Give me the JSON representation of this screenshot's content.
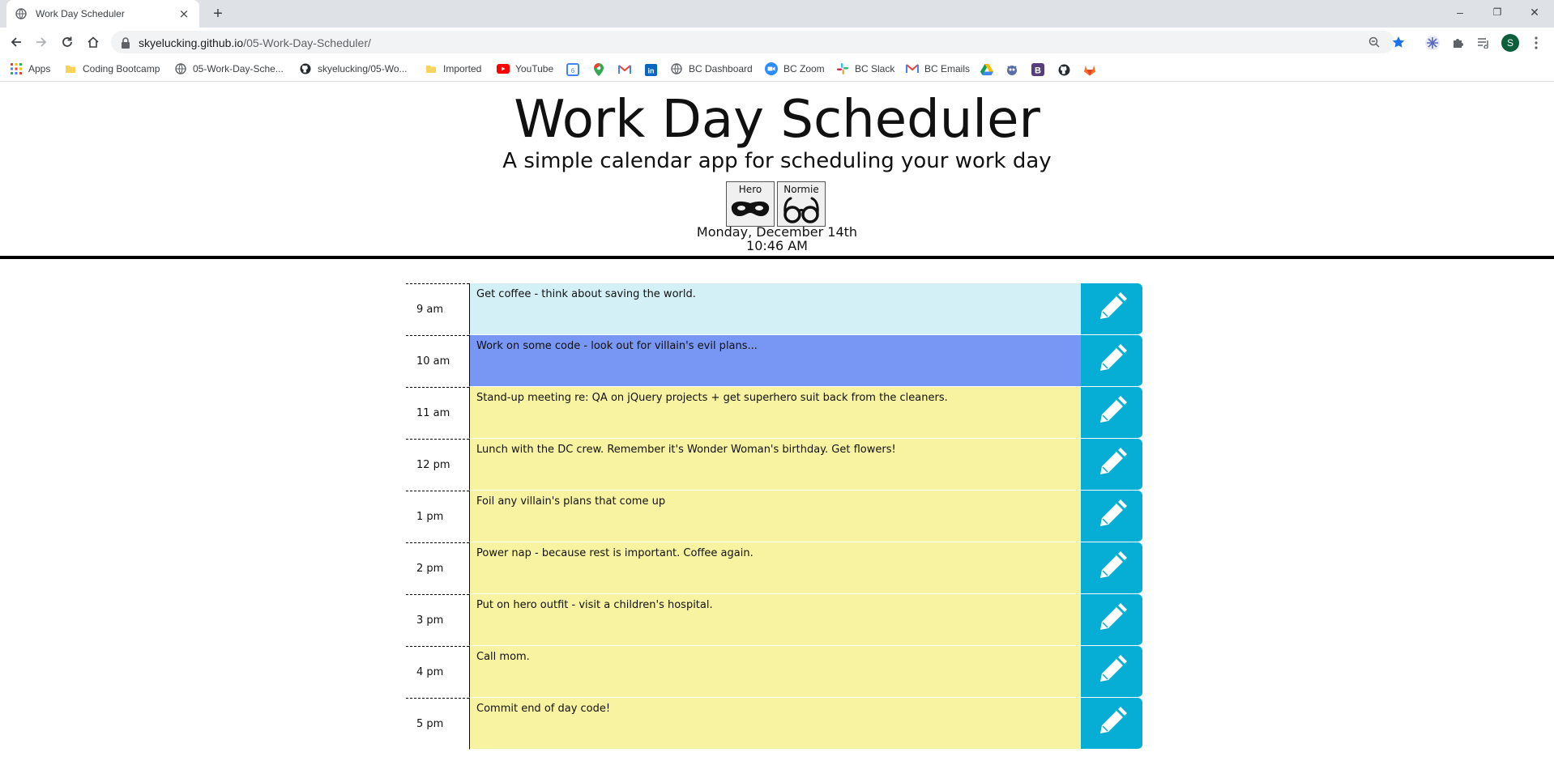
{
  "browser": {
    "tab_title": "Work Day Scheduler",
    "tab_close": "×",
    "new_tab": "+",
    "url_host": "skyelucking.github.io",
    "url_path": "/05-Work-Day-Scheduler/",
    "profile_initial": "S",
    "window_controls": {
      "minimize": "–",
      "restore": "❐",
      "close": "✕"
    }
  },
  "bookmarks": [
    {
      "label": "Apps",
      "icon": "apps-grid-icon"
    },
    {
      "label": "Coding Bootcamp",
      "icon": "folder-icon"
    },
    {
      "label": "05-Work-Day-Sche...",
      "icon": "globe-icon"
    },
    {
      "label": "skyelucking/05-Wo...",
      "icon": "github-icon"
    },
    {
      "label": "Imported",
      "icon": "folder-icon"
    },
    {
      "label": "YouTube",
      "icon": "youtube-icon"
    },
    {
      "label": "BC Dashboard",
      "icon": "globe-icon"
    },
    {
      "label": "BC Zoom",
      "icon": "zoom-icon"
    },
    {
      "label": "BC Slack",
      "icon": "slack-icon"
    },
    {
      "label": "BC Emails",
      "icon": "gmail-icon"
    }
  ],
  "header": {
    "title": "Work Day Scheduler",
    "subtitle": "A simple calendar app for scheduling your work day",
    "persona_hero": "Hero",
    "persona_normie": "Normie",
    "date": "Monday, December 14th",
    "time": "10:46 AM"
  },
  "schedule": [
    {
      "hour": "9 am",
      "text": "Get coffee - think about saving the world.",
      "state": "past"
    },
    {
      "hour": "10 am",
      "text": "Work on some code - look out for villain's evil plans...",
      "state": "present"
    },
    {
      "hour": "11 am",
      "text": "Stand-up meeting re: QA on jQuery projects + get superhero suit back from the cleaners.",
      "state": "future"
    },
    {
      "hour": "12 pm",
      "text": "Lunch with the DC crew. Remember it's Wonder Woman's birthday. Get flowers!",
      "state": "future"
    },
    {
      "hour": "1 pm",
      "text": "Foil any villain's plans that come up",
      "state": "future"
    },
    {
      "hour": "2 pm",
      "text": "Power nap - because rest is important. Coffee again.",
      "state": "future"
    },
    {
      "hour": "3 pm",
      "text": "Put on hero outfit - visit a children's hospital.",
      "state": "future"
    },
    {
      "hour": "4 pm",
      "text": "Call mom.",
      "state": "future"
    },
    {
      "hour": "5 pm",
      "text": "Commit end of day code!",
      "state": "future"
    }
  ],
  "colors": {
    "past": "#d3f0f7",
    "present": "#7896f4",
    "future": "#f8f3a0",
    "save_button": "#06aed5"
  }
}
